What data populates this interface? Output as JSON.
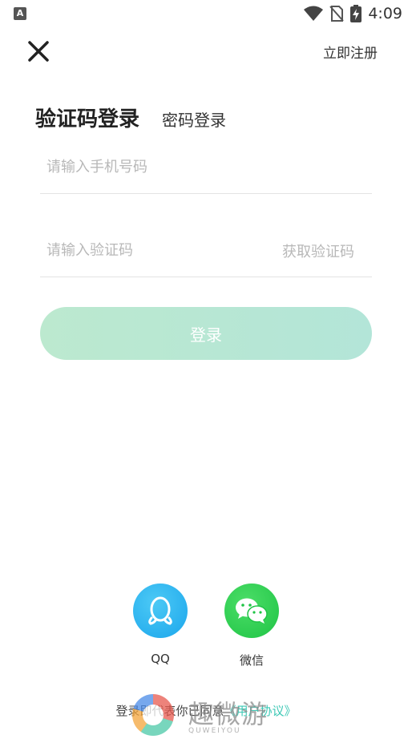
{
  "status_bar": {
    "time": "4:09",
    "app_icon_letter": "A"
  },
  "header": {
    "close_icon": "close-icon",
    "register_label": "立即注册"
  },
  "tabs": {
    "active_label": "验证码登录",
    "inactive_label": "密码登录"
  },
  "form": {
    "phone_placeholder": "请输入手机号码",
    "code_placeholder": "请输入验证码",
    "get_code_label": "获取验证码",
    "login_label": "登录"
  },
  "social": {
    "qq_label": "QQ",
    "wechat_label": "微信"
  },
  "agreement": {
    "prefix": "登录即代表你已同意",
    "link": "《用户协议》"
  },
  "watermark": {
    "title": "趣微游",
    "subtitle": "QUWEIYOU"
  },
  "colors": {
    "login_gradient_start": "#bce9cf",
    "login_gradient_end": "#b3e5d8",
    "qq_blue": "#1ba6ec",
    "wechat_green": "#1fc445",
    "link_color": "#3cc8b5",
    "placeholder_gray": "#b8b8b8"
  }
}
